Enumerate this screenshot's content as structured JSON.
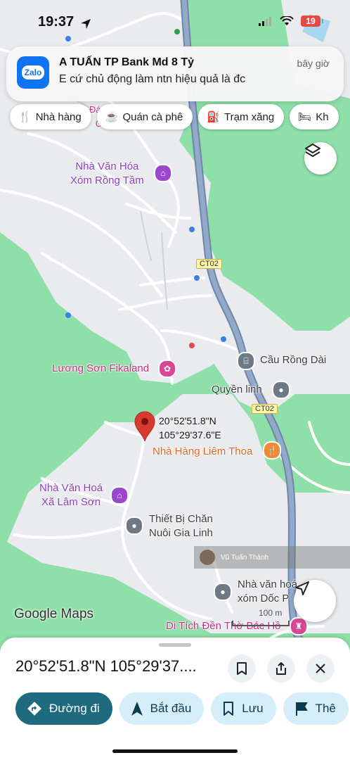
{
  "status": {
    "time": "19:37",
    "battery": "19"
  },
  "notification": {
    "app_icon_text": "Zalo",
    "title": "A TUẤN TP Bank Md 8 Tỷ",
    "body": "E cứ chủ động làm ntn hiệu quả là đc",
    "time": "bây giờ"
  },
  "chips": [
    {
      "label": "Nhà hàng"
    },
    {
      "label": "Quán cà phê"
    },
    {
      "label": "Trạm xăng"
    },
    {
      "label": "Kh"
    }
  ],
  "map": {
    "road_labels": [
      "CT02",
      "CT02"
    ],
    "places": {
      "nha_van_hoa_rong_tam": "Nhà Văn Hóa\nXóm Rồng Tầm",
      "top_partial": "Đá Cầ\nCol",
      "cau_rong_dai": "Cầu Rồng Dài",
      "quyen_linh": "Quyền linh",
      "luong_son_fikaland": "Lương Sơn Fikaland",
      "nha_hang_liem_thoa": "Nhà Hàng Liêm Thoa",
      "nha_van_hoa_lam_son": "Nhà Văn Hoá\nXã Lâm Sơn",
      "thiet_bi": "Thiết Bị Chăn\nNuôi Gia Linh",
      "nha_van_hoa_doc": "Nhà văn hoá\nxóm Dốc P",
      "di_tich": "Di Tích Đền Thờ Bác Hồ"
    },
    "pin_coords": "20°52'51.8\"N\n105°29'37.6\"E",
    "watermark": "Vũ Tuấn Thành",
    "logo": "Google Maps",
    "scale": "100 m"
  },
  "sheet": {
    "title": "20°52'51.8\"N 105°29'37....",
    "actions": [
      {
        "label": "Đường đi"
      },
      {
        "label": "Bắt đầu"
      },
      {
        "label": "Lưu"
      },
      {
        "label": "Thê"
      }
    ]
  },
  "colors": {
    "accent": "#1e6a7f",
    "action_bg": "#d6eef9",
    "map_green": "#8fdfa8",
    "map_area": "#e8eaed",
    "highway": "#8ea5c4",
    "pin": "#d93a2f"
  }
}
